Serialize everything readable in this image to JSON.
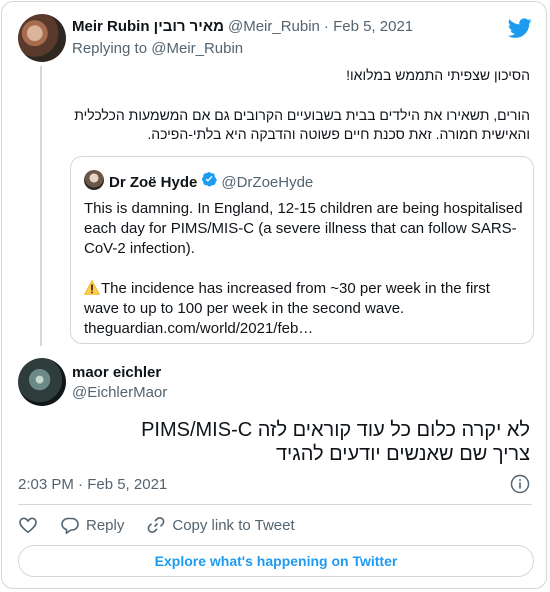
{
  "colors": {
    "accent": "#1d9bf0",
    "text": "#0f1419",
    "muted": "#536471",
    "border": "#cfd9de"
  },
  "parent_tweet": {
    "author_name": "Meir Rubin מאיר רובין",
    "handle": "@Meir_Rubin",
    "date": "· Feb 5, 2021",
    "replying_prefix": "Replying to",
    "replying_handle": "@Meir_Rubin",
    "text_line1": "הסיכון שצפיתי התממש במלואו!",
    "text_line2": "הורים, תשאירו את הילדים בבית בשבועיים הקרובים גם אם המשמעות הכלכלית והאישית חמורה. זאת סכנת חיים פשוטה והדבקה היא בלתי-הפיכה.",
    "avatar_icon": "avatar-photo"
  },
  "quoted_tweet": {
    "author_name": "Dr Zoë Hyde",
    "handle": "@DrZoeHyde",
    "verified_icon": "verified-badge-icon",
    "paragraph1": "This is damning. In England, 12-15 children are being hospitalised each day for PIMS/MIS-C (a severe illness that can follow SARS-CoV-2 infection).",
    "paragraph2": "The incidence has increased from ~30 per week in the first wave to up to 100 per week in the second wave.",
    "link": "theguardian.com/world/2021/feb…",
    "warning_icon": "warning-emoji"
  },
  "reply_tweet": {
    "author_name": "maor eichler",
    "handle": "@EichlerMaor",
    "text_line1": "לא יקרה כלום כל עוד קוראים לזה PIMS/MIS-C",
    "text_line2": "צריך שם שאנשים יודעים להגיד",
    "timestamp": "2:03 PM · Feb 5, 2021"
  },
  "actions": {
    "like_icon": "heart-icon",
    "reply_label": "Reply",
    "copy_label": "Copy link to Tweet"
  },
  "explore_button": "Explore what's happening on Twitter",
  "brand_icon": "twitter-bird-icon"
}
